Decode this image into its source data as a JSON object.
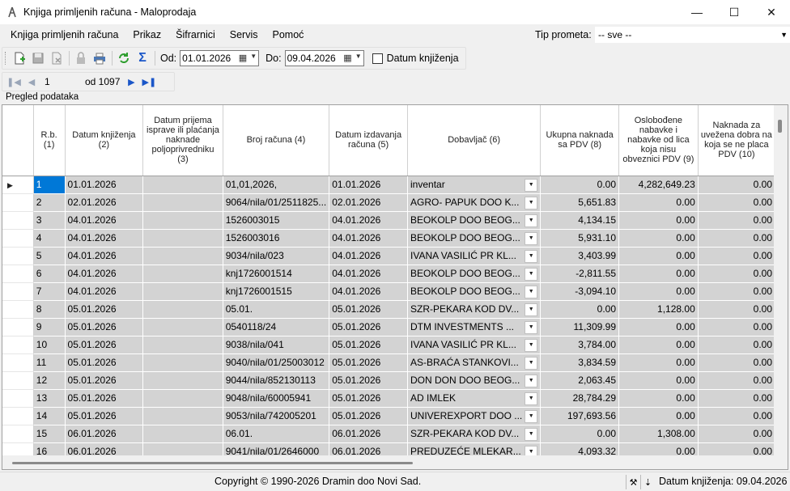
{
  "window": {
    "title": "Knjiga primljenih računa - Maloprodaja"
  },
  "menu": [
    "Knjiga primljenih računa",
    "Prikaz",
    "Šifrarnici",
    "Servis",
    "Pomoć"
  ],
  "tip_prometa": {
    "label": "Tip prometa:",
    "value": "-- sve --"
  },
  "toolbar": {
    "od_label": "Od:",
    "od_value": "01.01.2026",
    "do_label": "Do:",
    "do_value": "09.04.2026",
    "datum_knjizenja_label": "Datum knjiženja",
    "datum_knjizenja_checked": false
  },
  "navigator": {
    "position": "1",
    "of_label": "od 1097"
  },
  "section_label": "Pregled podataka",
  "grid": {
    "columns": [
      "R.b. (1)",
      "Datum knjiženja (2)",
      "Datum prijema isprave ili plaćanja naknade poljoprivredniku (3)",
      "Broj računa (4)",
      "Datum izdavanja računa (5)",
      "Dobavljač (6)",
      "Ukupna naknada sa PDV (8)",
      "Oslobođene nabavke i nabavke od lica koja nisu obveznici PDV (9)",
      "Naknada za uvežena dobra na koja se ne placa PDV (10)"
    ],
    "rows": [
      {
        "rb": "1",
        "datum": "01.01.2026",
        "prijem": "",
        "broj": "01,01,2026,",
        "izdavanje": "01.01.2026",
        "dobavljac": "inventar",
        "ukupno": "0.00",
        "oslobodjene": "4,282,649.23",
        "uvezena": "0.00"
      },
      {
        "rb": "2",
        "datum": "02.01.2026",
        "prijem": "",
        "broj": "9064/nila/01/2511825...",
        "izdavanje": "02.01.2026",
        "dobavljac": "AGRO- PAPUK DOO  K...",
        "ukupno": "5,651.83",
        "oslobodjene": "0.00",
        "uvezena": "0.00"
      },
      {
        "rb": "3",
        "datum": "04.01.2026",
        "prijem": "",
        "broj": "1526003015",
        "izdavanje": "04.01.2026",
        "dobavljac": "BEOKOLP DOO BEOG...",
        "ukupno": "4,134.15",
        "oslobodjene": "0.00",
        "uvezena": "0.00"
      },
      {
        "rb": "4",
        "datum": "04.01.2026",
        "prijem": "",
        "broj": "1526003016",
        "izdavanje": "04.01.2026",
        "dobavljac": "BEOKOLP DOO BEOG...",
        "ukupno": "5,931.10",
        "oslobodjene": "0.00",
        "uvezena": "0.00"
      },
      {
        "rb": "5",
        "datum": "04.01.2026",
        "prijem": "",
        "broj": "9034/nila/023",
        "izdavanje": "04.01.2026",
        "dobavljac": "IVANA VASILIĆ PR KL...",
        "ukupno": "3,403.99",
        "oslobodjene": "0.00",
        "uvezena": "0.00"
      },
      {
        "rb": "6",
        "datum": "04.01.2026",
        "prijem": "",
        "broj": "knj1726001514",
        "izdavanje": "04.01.2026",
        "dobavljac": "BEOKOLP DOO BEOG...",
        "ukupno": "-2,811.55",
        "oslobodjene": "0.00",
        "uvezena": "0.00"
      },
      {
        "rb": "7",
        "datum": "04.01.2026",
        "prijem": "",
        "broj": "knj1726001515",
        "izdavanje": "04.01.2026",
        "dobavljac": "BEOKOLP DOO BEOG...",
        "ukupno": "-3,094.10",
        "oslobodjene": "0.00",
        "uvezena": "0.00"
      },
      {
        "rb": "8",
        "datum": "05.01.2026",
        "prijem": "",
        "broj": "05.01.",
        "izdavanje": "05.01.2026",
        "dobavljac": "SZR-PEKARA KOD DV...",
        "ukupno": "0.00",
        "oslobodjene": "1,128.00",
        "uvezena": "0.00"
      },
      {
        "rb": "9",
        "datum": "05.01.2026",
        "prijem": "",
        "broj": "0540118/24",
        "izdavanje": "05.01.2026",
        "dobavljac": "DTM INVESTMENTS ...",
        "ukupno": "11,309.99",
        "oslobodjene": "0.00",
        "uvezena": "0.00"
      },
      {
        "rb": "10",
        "datum": "05.01.2026",
        "prijem": "",
        "broj": "9038/nila/041",
        "izdavanje": "05.01.2026",
        "dobavljac": "IVANA VASILIĆ PR KL...",
        "ukupno": "3,784.00",
        "oslobodjene": "0.00",
        "uvezena": "0.00"
      },
      {
        "rb": "11",
        "datum": "05.01.2026",
        "prijem": "",
        "broj": "9040/nila/01/25003012",
        "izdavanje": "05.01.2026",
        "dobavljac": "AS-BRAĆA STANKOVI...",
        "ukupno": "3,834.59",
        "oslobodjene": "0.00",
        "uvezena": "0.00"
      },
      {
        "rb": "12",
        "datum": "05.01.2026",
        "prijem": "",
        "broj": "9044/nila/852130113",
        "izdavanje": "05.01.2026",
        "dobavljac": "DON DON DOO BEOG...",
        "ukupno": "2,063.45",
        "oslobodjene": "0.00",
        "uvezena": "0.00"
      },
      {
        "rb": "13",
        "datum": "05.01.2026",
        "prijem": "",
        "broj": "9048/nila/60005941",
        "izdavanje": "05.01.2026",
        "dobavljac": "AD IMLEK",
        "ukupno": "28,784.29",
        "oslobodjene": "0.00",
        "uvezena": "0.00"
      },
      {
        "rb": "14",
        "datum": "05.01.2026",
        "prijem": "",
        "broj": "9053/nila/742005201",
        "izdavanje": "05.01.2026",
        "dobavljac": "UNIVEREXPORT DOO ...",
        "ukupno": "197,693.56",
        "oslobodjene": "0.00",
        "uvezena": "0.00"
      },
      {
        "rb": "15",
        "datum": "06.01.2026",
        "prijem": "",
        "broj": "06.01.",
        "izdavanje": "06.01.2026",
        "dobavljac": "SZR-PEKARA KOD DV...",
        "ukupno": "0.00",
        "oslobodjene": "1,308.00",
        "uvezena": "0.00"
      },
      {
        "rb": "16",
        "datum": "06.01.2026",
        "prijem": "",
        "broj": "9041/nila/01/2646000",
        "izdavanje": "06.01.2026",
        "dobavljac": "PREDUZEĆE MLEKAR...",
        "ukupno": "4,093.32",
        "oslobodjene": "0.00",
        "uvezena": "0.00"
      }
    ]
  },
  "status": {
    "copyright": "Copyright © 1990-2026 Dramin doo Novi Sad.",
    "datum_knjizenja": "Datum knjiženja: 09.04.2026"
  },
  "colors": {
    "selection": "#0078d7",
    "cell_bg": "#d3d3d3",
    "nav_active": "#1a56c8"
  }
}
